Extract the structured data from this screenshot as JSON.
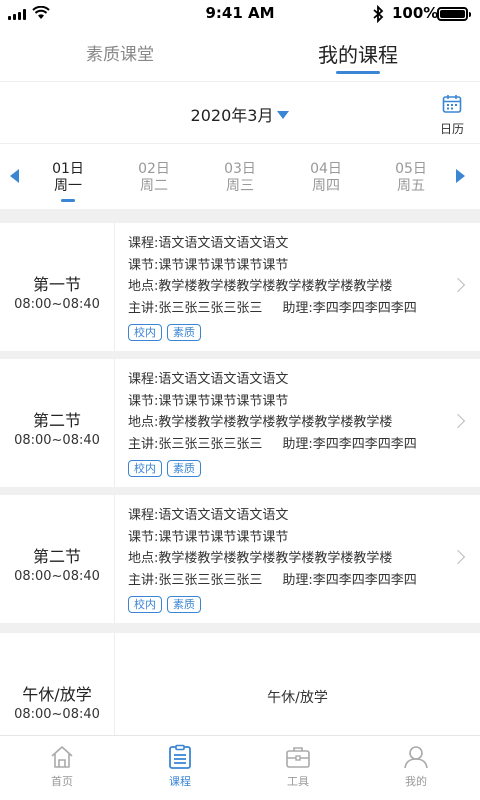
{
  "status_bar": {
    "time": "9:41 AM",
    "battery": "100%"
  },
  "top_tabs": [
    {
      "label": "素质课堂",
      "active": false
    },
    {
      "label": "我的课程",
      "active": true
    }
  ],
  "month_selector": {
    "label": "2020年3月",
    "calendar_label": "日历"
  },
  "week": [
    {
      "date": "01日",
      "weekday": "周一",
      "active": true
    },
    {
      "date": "02日",
      "weekday": "周二",
      "active": false
    },
    {
      "date": "03日",
      "weekday": "周三",
      "active": false
    },
    {
      "date": "04日",
      "weekday": "周四",
      "active": false
    },
    {
      "date": "05日",
      "weekday": "周五",
      "active": false
    }
  ],
  "courses": [
    {
      "period": "第一节",
      "time": "08:00~08:40",
      "course": "课程:语文语文语文语文语文",
      "section": "课节:课节课节课节课节课节",
      "location": "地点:教学楼教学楼教学楼教学楼教学楼教学楼",
      "lecturer": "主讲:张三张三张三张三",
      "assistant": "助理:李四李四李四李四",
      "tags": [
        "校内",
        "素质"
      ]
    },
    {
      "period": "第二节",
      "time": "08:00~08:40",
      "course": "课程:语文语文语文语文语文",
      "section": "课节:课节课节课节课节课节",
      "location": "地点:教学楼教学楼教学楼教学楼教学楼教学楼",
      "lecturer": "主讲:张三张三张三张三",
      "assistant": "助理:李四李四李四李四",
      "tags": [
        "校内",
        "素质"
      ]
    },
    {
      "period": "第二节",
      "time": "08:00~08:40",
      "course": "课程:语文语文语文语文语文",
      "section": "课节:课节课节课节课节课节",
      "location": "地点:教学楼教学楼教学楼教学楼教学楼教学楼",
      "lecturer": "主讲:张三张三张三张三",
      "assistant": "助理:李四李四李四李四",
      "tags": [
        "校内",
        "素质"
      ]
    }
  ],
  "break_row": {
    "period": "午休/放学",
    "time": "08:00~08:40",
    "label": "午休/放学"
  },
  "bottom_nav": [
    {
      "label": "首页",
      "icon": "home-icon",
      "active": false
    },
    {
      "label": "课程",
      "icon": "course-list-icon",
      "active": true
    },
    {
      "label": "工具",
      "icon": "toolbox-icon",
      "active": false
    },
    {
      "label": "我的",
      "icon": "user-icon",
      "active": false
    }
  ],
  "colors": {
    "accent": "#3a86d4",
    "inactive": "#999999",
    "divider": "#f0f0f0"
  }
}
